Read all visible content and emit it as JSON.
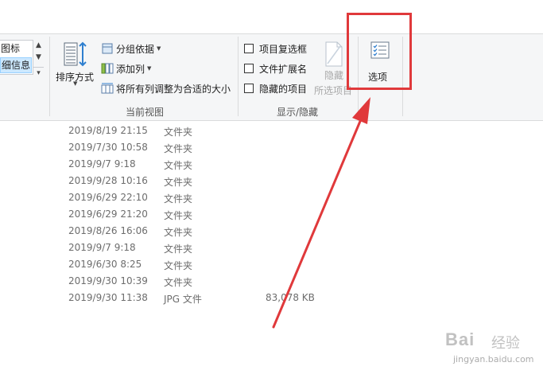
{
  "layout_panel": {
    "items": [
      {
        "label": "图标"
      },
      {
        "label": "细信息",
        "selected": true
      }
    ]
  },
  "current_view": {
    "sort_label": "排序方式",
    "group_by_label": "分组依据",
    "add_column_label": "添加列",
    "fit_columns_label": "将所有列调整为合适的大小",
    "group_label": "当前视图"
  },
  "show_hide": {
    "checkboxes": [
      {
        "label": "项目复选框",
        "checked": false
      },
      {
        "label": "文件扩展名",
        "checked": false
      },
      {
        "label": "隐藏的项目",
        "checked": false
      }
    ],
    "hide_selected_line1": "隐藏",
    "hide_selected_line2": "所选项目",
    "group_label": "显示/隐藏"
  },
  "options": {
    "label": "选项"
  },
  "highlight_color": "#e0393b",
  "files": [
    {
      "date": "2019/8/19 21:15",
      "type": "文件夹",
      "size": ""
    },
    {
      "date": "2019/7/30 10:58",
      "type": "文件夹",
      "size": ""
    },
    {
      "date": "2019/9/7 9:18",
      "type": "文件夹",
      "size": ""
    },
    {
      "date": "2019/9/28 10:16",
      "type": "文件夹",
      "size": ""
    },
    {
      "date": "2019/6/29 22:10",
      "type": "文件夹",
      "size": ""
    },
    {
      "date": "2019/6/29 21:20",
      "type": "文件夹",
      "size": ""
    },
    {
      "date": "2019/8/26 16:06",
      "type": "文件夹",
      "size": ""
    },
    {
      "date": "2019/9/7 9:18",
      "type": "文件夹",
      "size": ""
    },
    {
      "date": "2019/6/30 8:25",
      "type": "文件夹",
      "size": ""
    },
    {
      "date": "2019/9/30 10:39",
      "type": "文件夹",
      "size": ""
    },
    {
      "date": "2019/9/30 11:38",
      "type": "JPG 文件",
      "size": "83,078 KB"
    }
  ],
  "watermark": {
    "brand": "Bai",
    "brand_cn": "经验",
    "url": "jingyan.baidu.com"
  }
}
